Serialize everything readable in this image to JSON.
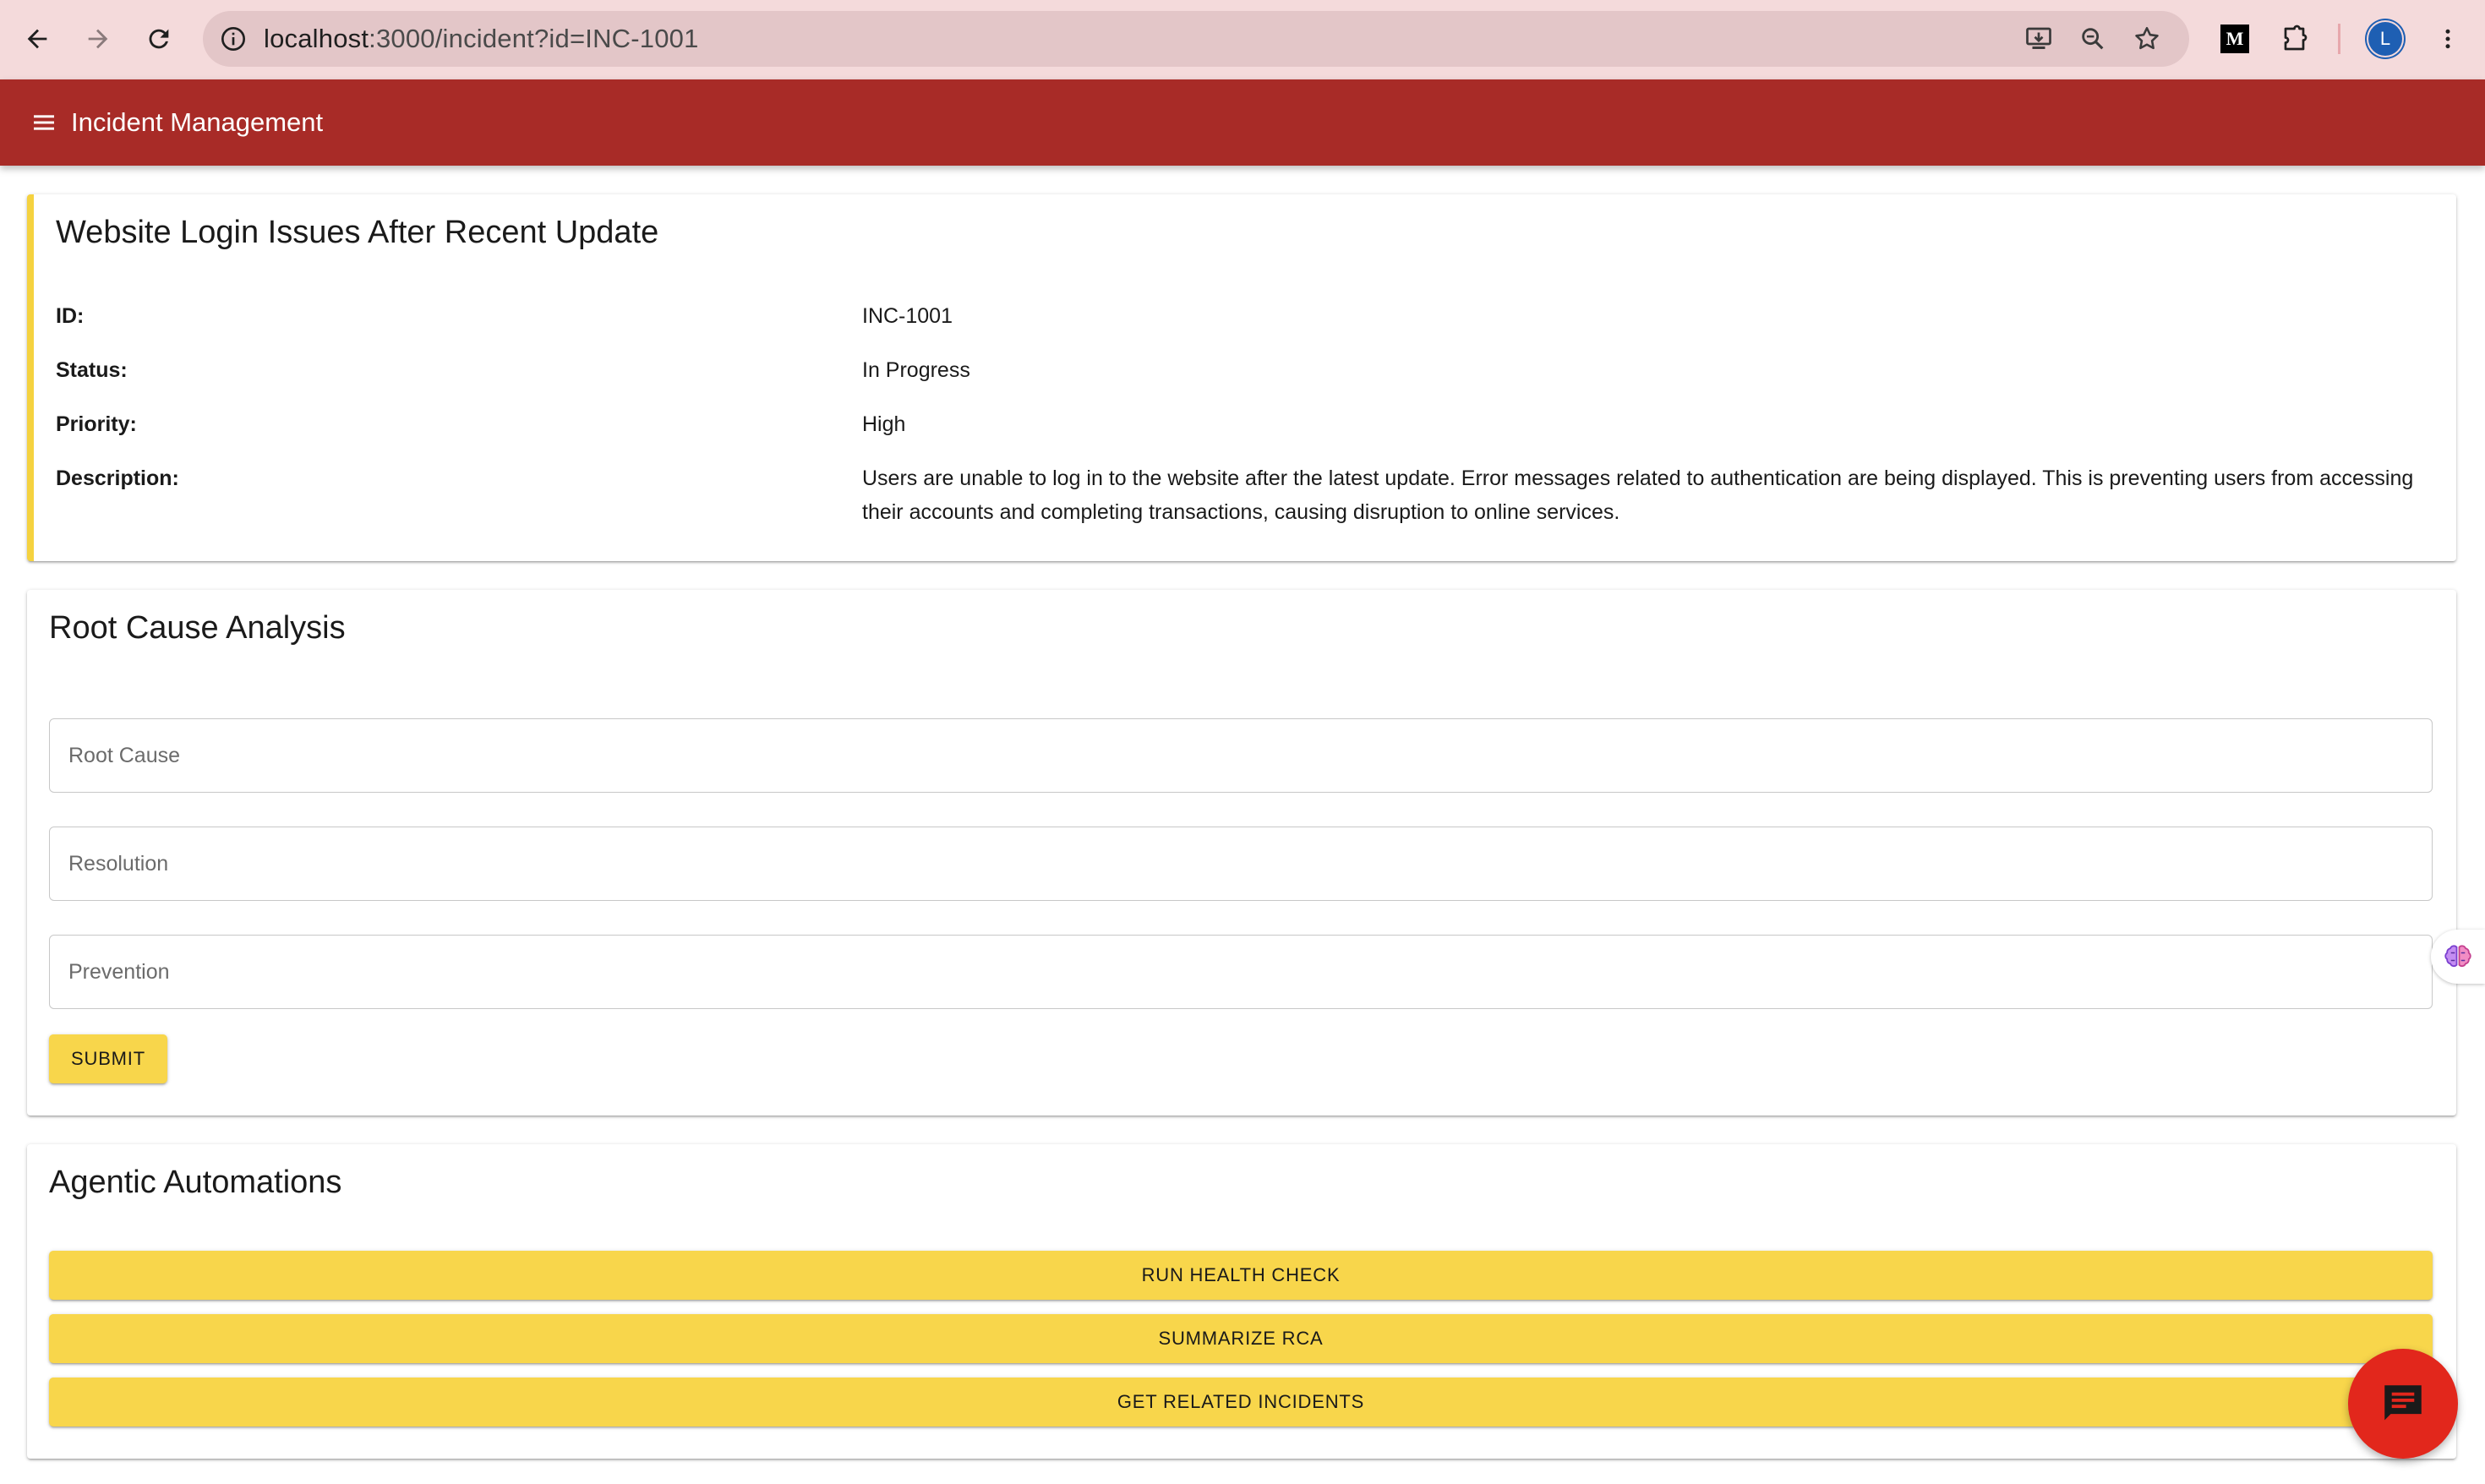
{
  "browser": {
    "url_host": "localhost",
    "url_rest": ":3000/incident?id=INC-1001",
    "extension_letter": "M",
    "profile_initial": "L"
  },
  "app": {
    "title": "Incident Management",
    "accent_color": "#a82b27",
    "button_color": "#f8d64b"
  },
  "incident": {
    "title": "Website Login Issues After Recent Update",
    "fields": [
      {
        "label": "ID:",
        "value": "INC-1001"
      },
      {
        "label": "Status:",
        "value": "In Progress"
      },
      {
        "label": "Priority:",
        "value": "High"
      },
      {
        "label": "Description:",
        "value": "Users are unable to log in to the website after the latest update. Error messages related to authentication are being displayed. This is preventing users from accessing their accounts and completing transactions, causing disruption to online services."
      }
    ]
  },
  "rca": {
    "title": "Root Cause Analysis",
    "root_cause_placeholder": "Root Cause",
    "resolution_placeholder": "Resolution",
    "prevention_placeholder": "Prevention",
    "submit_label": "SUBMIT"
  },
  "automations": {
    "title": "Agentic Automations",
    "buttons": [
      "RUN HEALTH CHECK",
      "SUMMARIZE RCA",
      "GET RELATED INCIDENTS"
    ]
  }
}
